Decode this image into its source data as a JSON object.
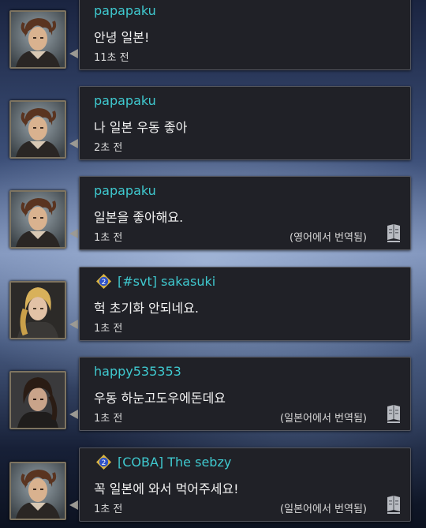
{
  "messages": [
    {
      "user": "papapaku",
      "text": "안녕 일본!",
      "time": "11초 전",
      "translation": "",
      "badge": "",
      "avatar": "male-warrior-avatar"
    },
    {
      "user": "papapaku",
      "text": "나 일본 우동 좋아",
      "time": "2초 전",
      "translation": "",
      "badge": "",
      "avatar": "male-warrior-avatar"
    },
    {
      "user": "papapaku",
      "text": "일본을 좋아해요.",
      "time": "1초 전",
      "translation": "(영어에서 번역됨)",
      "badge": "",
      "avatar": "male-warrior-avatar"
    },
    {
      "user": "[#svt] sakasuki",
      "text": "헉 초기화 안되네요.",
      "time": "1초 전",
      "translation": "",
      "badge": "2",
      "avatar": "blonde-braid-avatar"
    },
    {
      "user": "happy535353",
      "text": "우동 하눈고도우에돈데요",
      "time": "1초 전",
      "translation": "(일본어에서 번역됨)",
      "badge": "",
      "avatar": "dark-haired-avatar"
    },
    {
      "user": "[COBA] The sebzy",
      "text": "꼭 일본에 와서 먹어주세요!",
      "time": "1초 전",
      "translation": "(일본어에서 번역됨)",
      "badge": "2",
      "avatar": "male-warrior-avatar"
    }
  ],
  "colors": {
    "username": "#3fc9cf",
    "text": "#f2f2f2",
    "bubble": "#202127",
    "badge_gold": "#d9b441",
    "badge_blue": "#2f52c7"
  },
  "icons": {
    "translate": "translate-book-icon",
    "rank": "rank-badge-icon"
  }
}
